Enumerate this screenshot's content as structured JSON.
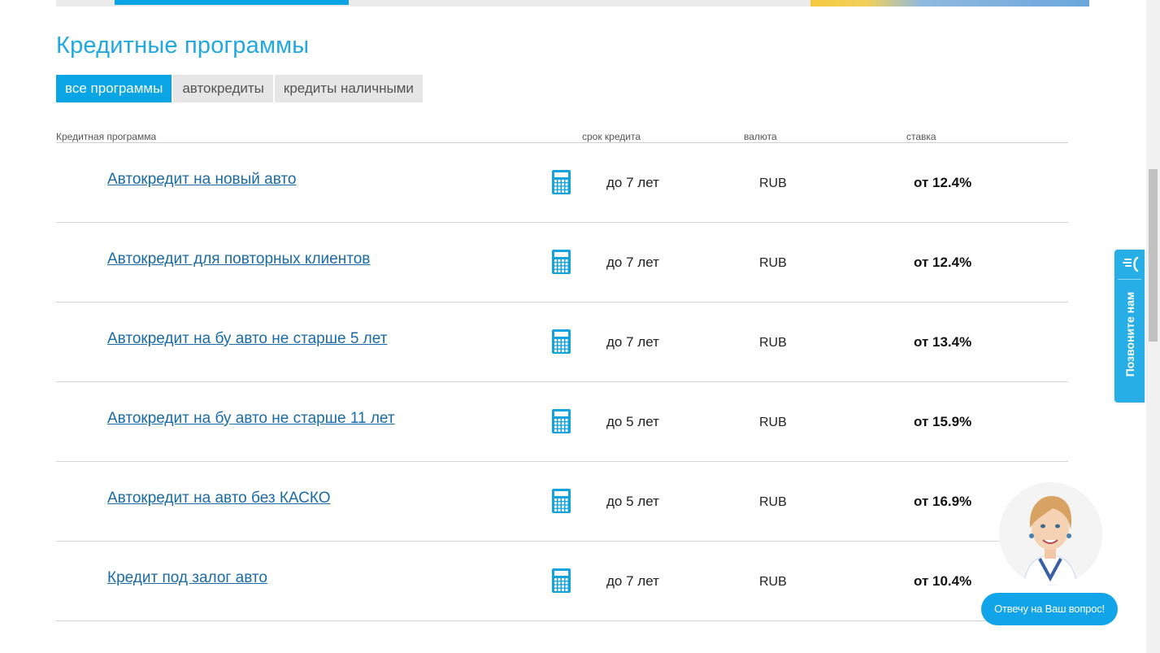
{
  "page": {
    "title": "Кредитные программы"
  },
  "tabs": [
    {
      "label": "все программы",
      "active": true
    },
    {
      "label": "автокредиты",
      "active": false
    },
    {
      "label": "кредиты наличными",
      "active": false
    }
  ],
  "table": {
    "headers": {
      "program": "Кредитная программа",
      "term": "срок кредита",
      "currency": "валюта",
      "rate": "ставка"
    },
    "rows": [
      {
        "name": "Автокредит на новый авто",
        "term": "до 7 лет",
        "currency": "RUB",
        "rate": "от 12.4%"
      },
      {
        "name": "Автокредит для повторных клиентов",
        "term": "до 7 лет",
        "currency": "RUB",
        "rate": "от 12.4%"
      },
      {
        "name": "Автокредит на бу авто не старше 5 лет",
        "term": "до 7 лет",
        "currency": "RUB",
        "rate": "от 13.4%"
      },
      {
        "name": "Автокредит на бу авто не старше 11 лет",
        "term": "до 5 лет",
        "currency": "RUB",
        "rate": "от 15.9%"
      },
      {
        "name": "Автокредит на авто без КАСКО",
        "term": "до 5 лет",
        "currency": "RUB",
        "rate": "от 16.9%"
      },
      {
        "name": "Кредит под залог авто",
        "term": "до 7 лет",
        "currency": "RUB",
        "rate": "от 10.4%"
      }
    ],
    "row_icon": "calculator-icon"
  },
  "widgets": {
    "call_us": "Позвоните нам",
    "call_us_icon": "phone-icon",
    "assistant_button": "Отвечу на Ваш вопрос!",
    "assistant_avatar": "assistant-avatar"
  },
  "colors": {
    "accent": "#0aa5e5",
    "link": "#1a6aa6",
    "title": "#22a8e0"
  }
}
